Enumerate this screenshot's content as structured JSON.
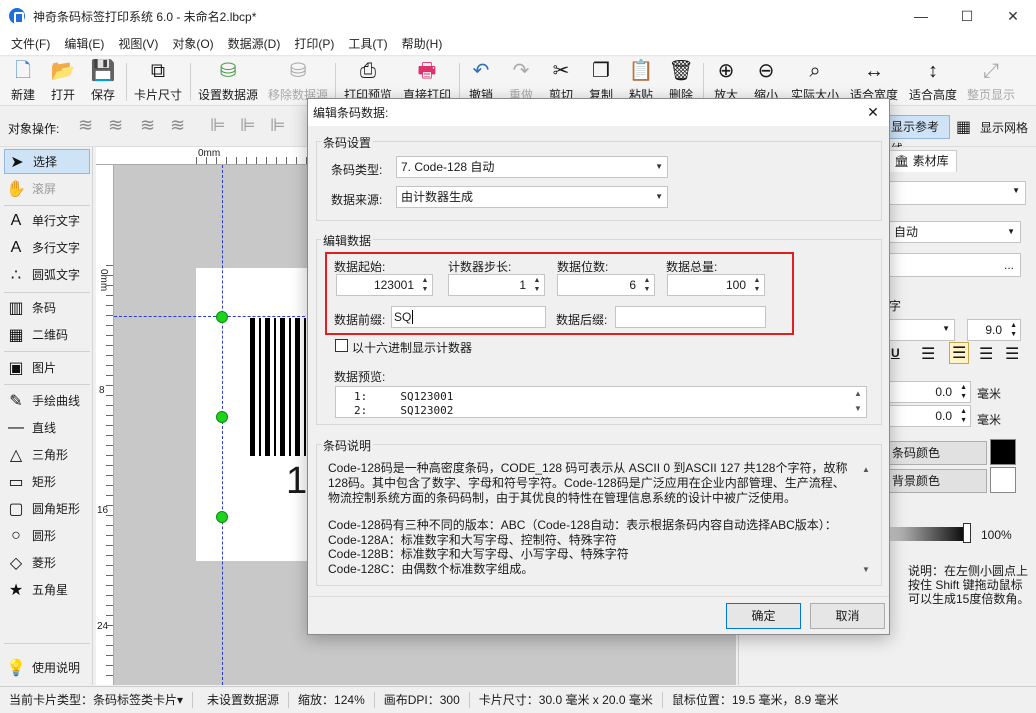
{
  "window": {
    "title": "神奇条码标签打印系统 6.0 - 未命名2.lbcp*",
    "min": "—",
    "max": "☐",
    "close": "✕"
  },
  "menu": [
    "文件(F)",
    "编辑(E)",
    "视图(V)",
    "对象(O)",
    "数据源(D)",
    "打印(P)",
    "工具(T)",
    "帮助(H)"
  ],
  "toolbar": [
    {
      "label": "新建",
      "icon": "new-file-icon",
      "glyph": "🗋"
    },
    {
      "label": "打开",
      "icon": "open-icon",
      "glyph": "📂"
    },
    {
      "label": "保存",
      "icon": "save-icon",
      "glyph": "💾"
    },
    {
      "label": "卡片尺寸",
      "icon": "card-size-icon",
      "glyph": "⧉"
    },
    {
      "label": "设置数据源",
      "icon": "database-icon",
      "glyph": "⛁"
    },
    {
      "label": "移除数据源",
      "icon": "remove-database-icon",
      "glyph": "⛁",
      "disabled": true
    },
    {
      "label": "打印预览",
      "icon": "print-preview-icon",
      "glyph": "⎙"
    },
    {
      "label": "直接打印",
      "icon": "printer-icon",
      "glyph": "🖶"
    },
    {
      "label": "撤销",
      "icon": "undo-icon",
      "glyph": "↶"
    },
    {
      "label": "重做",
      "icon": "redo-icon",
      "glyph": "↷",
      "disabled": true
    },
    {
      "label": "剪切",
      "icon": "scissors-icon",
      "glyph": "✂"
    },
    {
      "label": "复制",
      "icon": "copy-icon",
      "glyph": "❐"
    },
    {
      "label": "粘贴",
      "icon": "paste-icon",
      "glyph": "📋"
    },
    {
      "label": "删除",
      "icon": "trash-icon",
      "glyph": "🗑"
    },
    {
      "label": "放大",
      "icon": "zoom-in-icon",
      "glyph": "⊕"
    },
    {
      "label": "缩小",
      "icon": "zoom-out-icon",
      "glyph": "⊖"
    },
    {
      "label": "实际大小",
      "icon": "actual-size-icon",
      "glyph": "⌕"
    },
    {
      "label": "适合宽度",
      "icon": "fit-width-icon",
      "glyph": "↔"
    },
    {
      "label": "适合高度",
      "icon": "fit-height-icon",
      "glyph": "↕"
    },
    {
      "label": "整页显示",
      "icon": "full-page-icon",
      "glyph": "⤢",
      "disabled": true
    }
  ],
  "ops": {
    "label": "对象操作:",
    "show_guides": "显示参考线",
    "show_grid": "显示网格"
  },
  "tools": [
    {
      "label": "选择",
      "icon": "arrow-cursor-icon",
      "glyph": "➤",
      "selected": true
    },
    {
      "label": "滚屏",
      "icon": "hand-icon",
      "glyph": "✋",
      "disabled": true
    },
    {
      "label": "单行文字",
      "icon": "single-line-text-icon",
      "glyph": "A"
    },
    {
      "label": "多行文字",
      "icon": "multi-line-text-icon",
      "glyph": "A"
    },
    {
      "label": "圆弧文字",
      "icon": "arc-text-icon",
      "glyph": "∴"
    },
    {
      "label": "条码",
      "icon": "barcode-icon",
      "glyph": "▥"
    },
    {
      "label": "二维码",
      "icon": "qrcode-icon",
      "glyph": "▦"
    },
    {
      "label": "图片",
      "icon": "image-icon",
      "glyph": "▣"
    },
    {
      "label": "手绘曲线",
      "icon": "pen-icon",
      "glyph": "✎"
    },
    {
      "label": "直线",
      "icon": "line-icon",
      "glyph": "—"
    },
    {
      "label": "三角形",
      "icon": "triangle-icon",
      "glyph": "△"
    },
    {
      "label": "矩形",
      "icon": "rectangle-icon",
      "glyph": "▭"
    },
    {
      "label": "圆角矩形",
      "icon": "rounded-rect-icon",
      "glyph": "▢"
    },
    {
      "label": "圆形",
      "icon": "circle-icon",
      "glyph": "○"
    },
    {
      "label": "菱形",
      "icon": "diamond-icon",
      "glyph": "◇"
    },
    {
      "label": "五角星",
      "icon": "star-icon",
      "glyph": "★"
    },
    {
      "label": "使用说明",
      "icon": "bulb-icon",
      "glyph": "💡"
    }
  ],
  "rulers": {
    "h0": "0mm",
    "v0": "0mm",
    "v8": "8",
    "v16": "16",
    "v24": "24"
  },
  "canvas": {
    "barcode_digit": "1"
  },
  "right": {
    "material_tab": "素材库",
    "auto": "自动",
    "more": "...",
    "zi": "字",
    "font_size": "9.0",
    "u": "U",
    "val1": "0.0",
    "unit1": "毫米",
    "val2": "0.0",
    "unit2": "毫米",
    "barcode_color": "条码颜色",
    "bg_color": "背景颜色",
    "opacity": "100%",
    "hint": "说明：在左侧小圆点上按住 Shift 键拖动鼠标可以生成15度倍数角。",
    "colors": {
      "barcode": "#000000",
      "background": "#ffffff"
    }
  },
  "status": {
    "card_type": "当前卡片类型：条码标签类卡片▾",
    "datasource": "未设置数据源",
    "zoom": "缩放：124%",
    "dpi": "画布DPI：300",
    "card_size": "卡片尺寸：30.0 毫米 x 20.0 毫米",
    "mouse": "鼠标位置：19.5 毫米，8.9 毫米"
  },
  "dialog": {
    "title": "编辑条码数据:",
    "close": "✕",
    "barcode_settings": {
      "group_title": "条码设置",
      "type_label": "条码类型:",
      "type_value": "7. Code-128 自动",
      "source_label": "数据来源:",
      "source_value": "由计数器生成"
    },
    "edit_data": {
      "group_title": "编辑数据",
      "start_label": "数据起始:",
      "start_value": "123001",
      "step_label": "计数器步长:",
      "step_value": "1",
      "digits_label": "数据位数:",
      "digits_value": "6",
      "total_label": "数据总量:",
      "total_value": "100",
      "prefix_label": "数据前缀:",
      "prefix_value": "SQ",
      "suffix_label": "数据后缀:",
      "suffix_value": "",
      "hex_label": "以十六进制显示计数器",
      "hex_checked": false,
      "preview_label": "数据预览:",
      "preview_lines": [
        "1:     SQ123001",
        "2:     SQ123002"
      ],
      "highlight_color": "#e02020"
    },
    "description": {
      "group_title": "条码说明",
      "paragraph1": "Code-128码是一种高密度条码，CODE_128 码可表示从 ASCII 0 到ASCII 127 共128个字符，故称128码。其中包含了数字、字母和符号字符。Code-128码是广泛应用在企业内部管理、生产流程、物流控制系统方面的条码码制，由于其优良的特性在管理信息系统的设计中被广泛使用。",
      "lines": [
        "Code-128码有三种不同的版本：ABC（Code-128自动：表示根据条码内容自动选择ABC版本）：",
        "Code-128A：标准数字和大写字母、控制符、特殊字符",
        "Code-128B：标准数字和大写字母、小写字母、特殊字符",
        "Code-128C：由偶数个标准数字组成。"
      ]
    },
    "ok": "确定",
    "cancel": "取消"
  }
}
